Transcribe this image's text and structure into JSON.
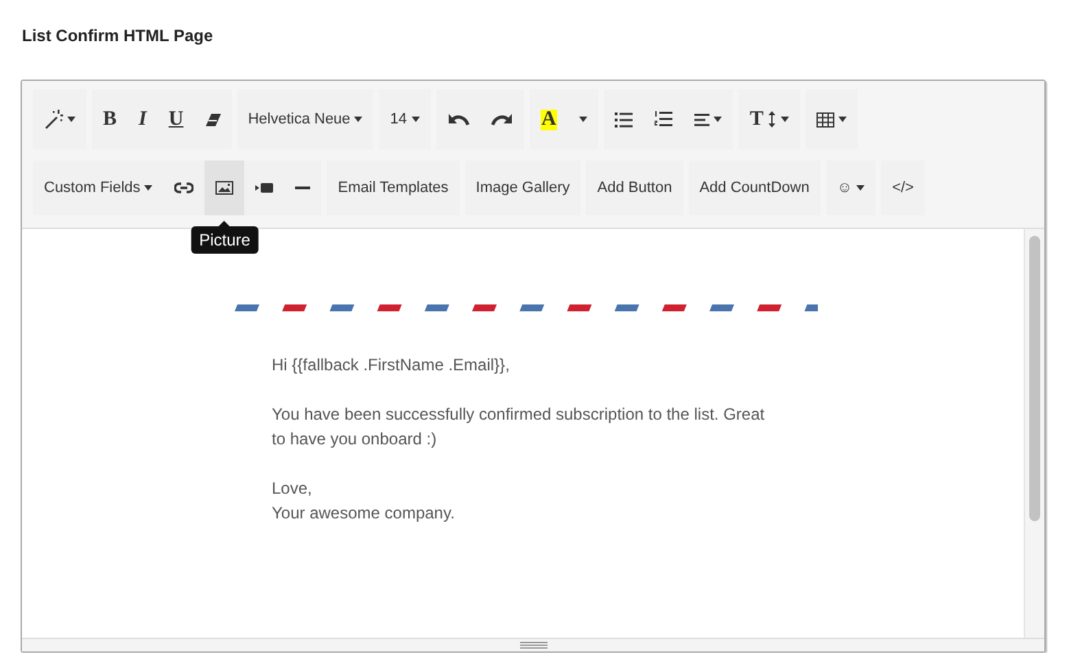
{
  "title": "List Confirm HTML Page",
  "toolbar_rows": [
    {
      "groups": [
        {
          "items": [
            {
              "kind": "wand",
              "dropdown": true
            }
          ]
        },
        {
          "items": [
            {
              "kind": "bold",
              "label": "B"
            },
            {
              "kind": "italic",
              "label": "I"
            },
            {
              "kind": "underline",
              "label": "U"
            },
            {
              "kind": "eraser"
            }
          ]
        },
        {
          "items": [
            {
              "kind": "text",
              "label": "Helvetica Neue",
              "dropdown": true
            }
          ]
        },
        {
          "items": [
            {
              "kind": "text",
              "label": "14",
              "dropdown": true
            }
          ]
        },
        {
          "items": [
            {
              "kind": "undo"
            },
            {
              "kind": "redo"
            }
          ]
        },
        {
          "items": [
            {
              "kind": "highlight",
              "label": "A"
            },
            {
              "kind": "caret"
            }
          ]
        },
        {
          "items": [
            {
              "kind": "bullets"
            },
            {
              "kind": "numbers"
            },
            {
              "kind": "align",
              "dropdown": true
            }
          ]
        },
        {
          "items": [
            {
              "kind": "height",
              "label": "T",
              "dropdown": true
            }
          ]
        },
        {
          "items": [
            {
              "kind": "table",
              "dropdown": true
            }
          ]
        }
      ]
    },
    {
      "groups": [
        {
          "items": [
            {
              "kind": "text",
              "label": "Custom Fields",
              "dropdown": true
            },
            {
              "kind": "link"
            },
            {
              "kind": "picture",
              "hovered": true,
              "tooltip": "Picture"
            },
            {
              "kind": "video"
            },
            {
              "kind": "rule"
            }
          ]
        },
        {
          "items": [
            {
              "kind": "text",
              "label": "Email Templates"
            }
          ]
        },
        {
          "items": [
            {
              "kind": "text",
              "label": "Image Gallery"
            }
          ]
        },
        {
          "items": [
            {
              "kind": "text",
              "label": "Add Button"
            }
          ]
        },
        {
          "items": [
            {
              "kind": "text",
              "label": "Add CountDown"
            }
          ]
        },
        {
          "items": [
            {
              "kind": "text",
              "label": "☺",
              "dropdown": true
            }
          ]
        },
        {
          "items": [
            {
              "kind": "text",
              "label": "</>"
            }
          ]
        }
      ]
    }
  ],
  "message": [
    {
      "lines": [
        "Hi {{fallback .FirstName .Email}},"
      ]
    },
    {
      "lines": [
        "You have been successfully confirmed subscription to the list. Great to have you onboard :)"
      ]
    },
    {
      "lines": [
        "Love,",
        "Your awesome company."
      ]
    }
  ]
}
